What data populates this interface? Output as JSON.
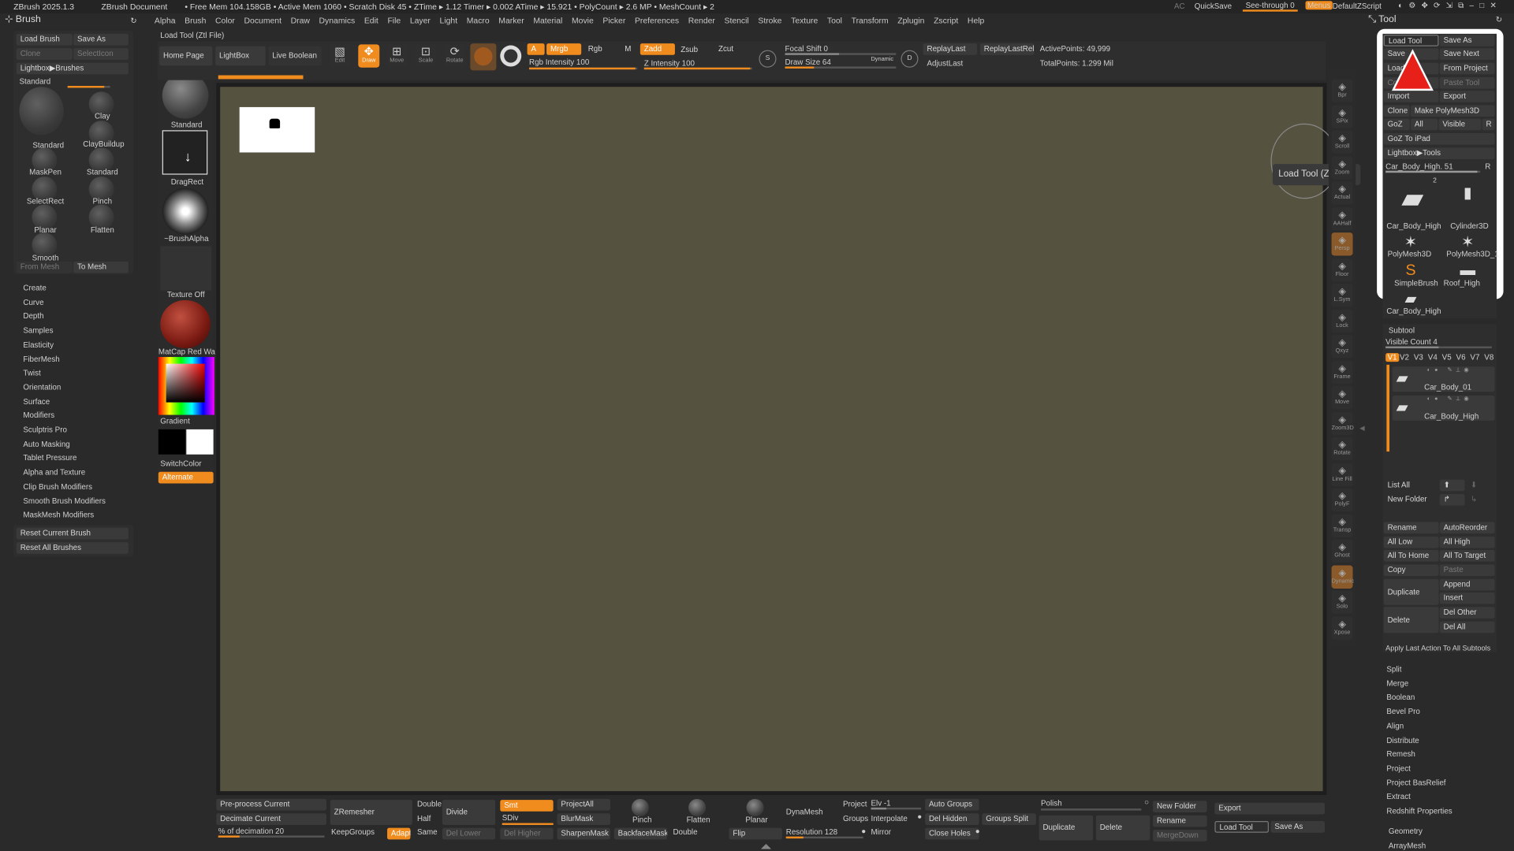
{
  "titlebar": {
    "app": "ZBrush 2025.1.3",
    "doc": "ZBrush Document",
    "stats": "• Free Mem 104.158GB • Active Mem 1060 • Scratch Disk 45 • ZTime ▸ 1.12 Timer ▸ 0.002 ATime ▸ 15.921 • PolyCount ▸ 2.6 MP • MeshCount ▸ 2",
    "ac": "AC",
    "quicksave": "QuickSave",
    "seethrough": "See-through 0",
    "menus": "Menus",
    "script": "DefaultZScript"
  },
  "menus": [
    "Alpha",
    "Brush",
    "Color",
    "Document",
    "Draw",
    "Dynamics",
    "Edit",
    "File",
    "Layer",
    "Light",
    "Macro",
    "Marker",
    "Material",
    "Movie",
    "Picker",
    "Preferences",
    "Render",
    "Stencil",
    "Stroke",
    "Texture",
    "Tool",
    "Transform",
    "Zplugin",
    "Zscript",
    "Help"
  ],
  "status_text": "Load Tool (Ztl File)",
  "brush_panel": {
    "title": "Brush",
    "load": "Load Brush",
    "saveas": "Save As",
    "clone": "Clone",
    "selecticon": "SelectIcon",
    "lightbox": "Lightbox▶Brushes",
    "standard": "Standard",
    "brushes": [
      "Standard",
      "Clay",
      "ClayBuildup",
      "MaskPen",
      "Standard",
      "SelectRect",
      "Pinch",
      "Planar",
      "Flatten",
      "Smooth"
    ],
    "frommesh": "From Mesh",
    "tomesh": "To Mesh",
    "items": [
      "Create",
      "Curve",
      "Depth",
      "Samples",
      "Elasticity",
      "FiberMesh",
      "Twist",
      "Orientation",
      "Surface",
      "Modifiers",
      "Sculptris Pro",
      "Auto Masking",
      "Tablet Pressure",
      "Alpha and Texture",
      "Clip Brush Modifiers",
      "Smooth Brush Modifiers",
      "MaskMesh Modifiers"
    ],
    "reset_current": "Reset Current Brush",
    "reset_all": "Reset All Brushes"
  },
  "shelf": {
    "standard": "Standard",
    "dragrect": "DragRect",
    "alpha": "~BrushAlpha",
    "texture": "Texture Off",
    "matcap": "MatCap Red Wa",
    "gradient": "Gradient",
    "switchcolor": "SwitchColor",
    "alternate": "Alternate"
  },
  "top": {
    "home": "Home Page",
    "lightbox": "LightBox",
    "liveboolean": "Live Boolean",
    "edit": "Edit",
    "draw": "Draw",
    "move": "Move",
    "scale": "Scale",
    "rotate": "Rotate",
    "a": "A",
    "mrgb": "Mrgb",
    "rgb": "Rgb",
    "m": "M",
    "zadd": "Zadd",
    "zsub": "Zsub",
    "zcut": "Zcut",
    "rgbint": "Rgb Intensity 100",
    "zint": "Z Intensity 100",
    "focal": "Focal Shift 0",
    "drawsize": "Draw Size 64",
    "dynamic": "Dynamic",
    "replay": "ReplayLast",
    "replayrel": "ReplayLastRel",
    "adjust": "AdjustLast",
    "activepoints": "ActivePoints: 49,999",
    "totalpoints": "TotalPoints: 1.299 Mil"
  },
  "tooltip": "Load Tool (Ztl File)",
  "rightshelf": [
    "Bpr",
    "SPix",
    "Scroll",
    "Zoom",
    "Actual",
    "AAHalf",
    "Persp",
    "Floor",
    "L.Sym",
    "Lock",
    "Qxyz",
    "Frame",
    "Move",
    "Zoom3D",
    "Rotate",
    "Line Fill",
    "PolyF",
    "Transp",
    "Ghost",
    "Dynamic",
    "Solo",
    "Xpose"
  ],
  "tool": {
    "title": "Tool",
    "load": "Load Tool",
    "saveas": "Save As",
    "save": "Save",
    "savenext": "Save Next",
    "loadtools": "Load",
    "fromproject": "From Project",
    "copy": "Copy",
    "pastetool": "Paste Tool",
    "import": "Import",
    "export": "Export",
    "clone": "Clone",
    "makepoly": "Make PolyMesh3D",
    "goz": "GoZ",
    "all": "All",
    "visible": "Visible",
    "r": "R",
    "gozipad": "GoZ To iPad",
    "lightbox": "Lightbox▶Tools",
    "current": "Car_Body_High. 51",
    "r2": "R",
    "count": "2",
    "thumbs": [
      "Car_Body_High",
      "Cylinder3D",
      "PolyMesh3D",
      "PolyMesh3D_1",
      "SimpleBrush",
      "Roof_High",
      "Car_Body_High",
      "Car_Body_High"
    ],
    "subtool": "Subtool",
    "visiblecount": "Visible Count 4",
    "versions": [
      "V1",
      "V2",
      "V3",
      "V4",
      "V5",
      "V6",
      "V7",
      "V8"
    ],
    "subtools": [
      "Car_Body_01",
      "Car_Body_High"
    ],
    "listall": "List All",
    "newfolder": "New Folder",
    "rename": "Rename",
    "autoreorder": "AutoReorder",
    "alllow": "All Low",
    "allhigh": "All High",
    "alltohome": "All To Home",
    "alltotarget": "All To Target",
    "copy2": "Copy",
    "paste": "Paste",
    "duplicate": "Duplicate",
    "append": "Append",
    "insert": "Insert",
    "delete": "Delete",
    "delother": "Del Other",
    "delall": "Del All",
    "applylast": "Apply Last Action To All Subtools",
    "sections": [
      "Split",
      "Merge",
      "Boolean",
      "Bevel Pro",
      "Align",
      "Distribute",
      "Remesh",
      "Project",
      "Project BasRelief",
      "Extract",
      "Redshift Properties"
    ],
    "geometry": "Geometry",
    "arraymesh": "ArrayMesh"
  },
  "bottom": {
    "preprocess": "Pre-process Current",
    "decimate": "Decimate Current",
    "pctdec": "% of decimation 20",
    "zremesher": "ZRemesher",
    "keepgroups": "KeepGroups",
    "double": "Double",
    "half": "Half",
    "adapt": "Adapt",
    "same": "Same",
    "divide": "Divide",
    "smt": "Smt",
    "sdiv": "SDiv",
    "dellower": "Del Lower",
    "delhigher": "Del Higher",
    "projectall": "ProjectAll",
    "blurmask": "BlurMask",
    "sharpenmask": "SharpenMask",
    "backfacemask": "BackfaceMask",
    "pinch": "Pinch",
    "flatten": "Flatten",
    "planar": "Planar",
    "double2": "Double",
    "flip": "Flip",
    "dynamesh": "DynaMesh",
    "resolution": "Resolution 128",
    "project": "Project",
    "elv": "Elv -1",
    "groups": "Groups",
    "interpolate": "Interpolate",
    "mirror": "Mirror",
    "autogroups": "Auto Groups",
    "delhidden": "Del Hidden",
    "closeholes": "Close Holes",
    "groupssplit": "Groups Split",
    "polish": "Polish",
    "duplicate": "Duplicate",
    "delete": "Delete",
    "newfolder": "New Folder",
    "rename": "Rename",
    "mergedown": "MergeDown",
    "export": "Export",
    "loadtool": "Load Tool",
    "saveas": "Save As"
  },
  "colors": {
    "accent": "#f08c1e",
    "canvas": "#55523f",
    "alert": "#e8201a"
  }
}
